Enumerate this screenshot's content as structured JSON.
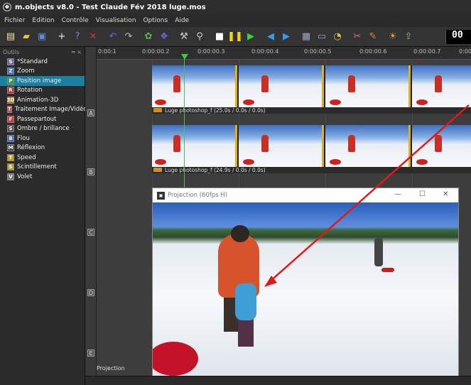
{
  "window": {
    "title": "m.objects v8.0 - Test Claude Fév 2018 luge.mos"
  },
  "menu": [
    "Fichier",
    "Edition",
    "Contrôle",
    "Visualisation",
    "Options",
    "Aide"
  ],
  "toolbar": {
    "icons": [
      "new-icon",
      "open-icon",
      "save-icon",
      "add-icon",
      "help-icon",
      "delete-icon",
      "undo-icon",
      "redo-icon",
      "group-icon",
      "ungroup-icon",
      "magic-icon",
      "wand-icon",
      "stop-icon",
      "pause-icon",
      "play-icon",
      "prev-icon",
      "next-icon",
      "chart-icon",
      "screen-icon",
      "clock-icon",
      "tools-icon",
      "pen-icon",
      "palette-icon",
      "export-icon"
    ],
    "timecode": "00"
  },
  "tools_panel": {
    "title": "Outils",
    "items": [
      {
        "label": "*Standard",
        "icon": "standard-icon",
        "glyph": "S",
        "color": "#6a6aa8"
      },
      {
        "label": "Zoom",
        "icon": "zoom-icon",
        "glyph": "Z",
        "color": "#3a7ac8"
      },
      {
        "label": "Position image",
        "icon": "position-icon",
        "glyph": "P",
        "color": "#3a9a3a",
        "selected": true
      },
      {
        "label": "Rotation",
        "icon": "rotation-icon",
        "glyph": "R",
        "color": "#c02a2a"
      },
      {
        "label": "Animation-3D",
        "icon": "animation3d-icon",
        "glyph": "3D",
        "color": "#c07a1a"
      },
      {
        "label": "Traitement Image/Vidéo",
        "icon": "processing-icon",
        "glyph": "T",
        "color": "#d04050"
      },
      {
        "label": "Passepartout",
        "icon": "passepartout-icon",
        "glyph": "F",
        "color": "#d83a3a"
      },
      {
        "label": "Ombre / brillance",
        "icon": "shadow-icon",
        "glyph": "S",
        "color": "#555"
      },
      {
        "label": "Flou",
        "icon": "blur-icon",
        "glyph": "B",
        "color": "#3a6ad0"
      },
      {
        "label": "Réflexion",
        "icon": "reflection-icon",
        "glyph": "M",
        "color": "#444"
      },
      {
        "label": "Speed",
        "icon": "speed-icon",
        "glyph": "T",
        "color": "#c0a01a"
      },
      {
        "label": "Scintillement",
        "icon": "flicker-icon",
        "glyph": "S",
        "color": "#c0a01a"
      },
      {
        "label": "Volet",
        "icon": "wipe-icon",
        "glyph": "V",
        "color": "#777"
      }
    ]
  },
  "tracks": {
    "letters": [
      "A",
      "B",
      "C",
      "D",
      "E"
    ],
    "clips": [
      {
        "label": "Luge photoshop_f (25.0s / 0.0s / 0.0s)"
      },
      {
        "label": "Luge photoshop_f (24.9s / 0.0s / 0.0s)"
      }
    ]
  },
  "ruler": {
    "ticks": [
      "0:00:1",
      "0:00:00.2",
      "0:00:00.3",
      "0:00:00.4",
      "0:00:00.5",
      "0:00:00.6",
      "0:00:00.7",
      "0:00"
    ]
  },
  "projection": {
    "title": "Projection (60fps H)",
    "controls": {
      "minimize": "—",
      "maximize": "☐",
      "close": "✕"
    },
    "caption": "Projection"
  }
}
